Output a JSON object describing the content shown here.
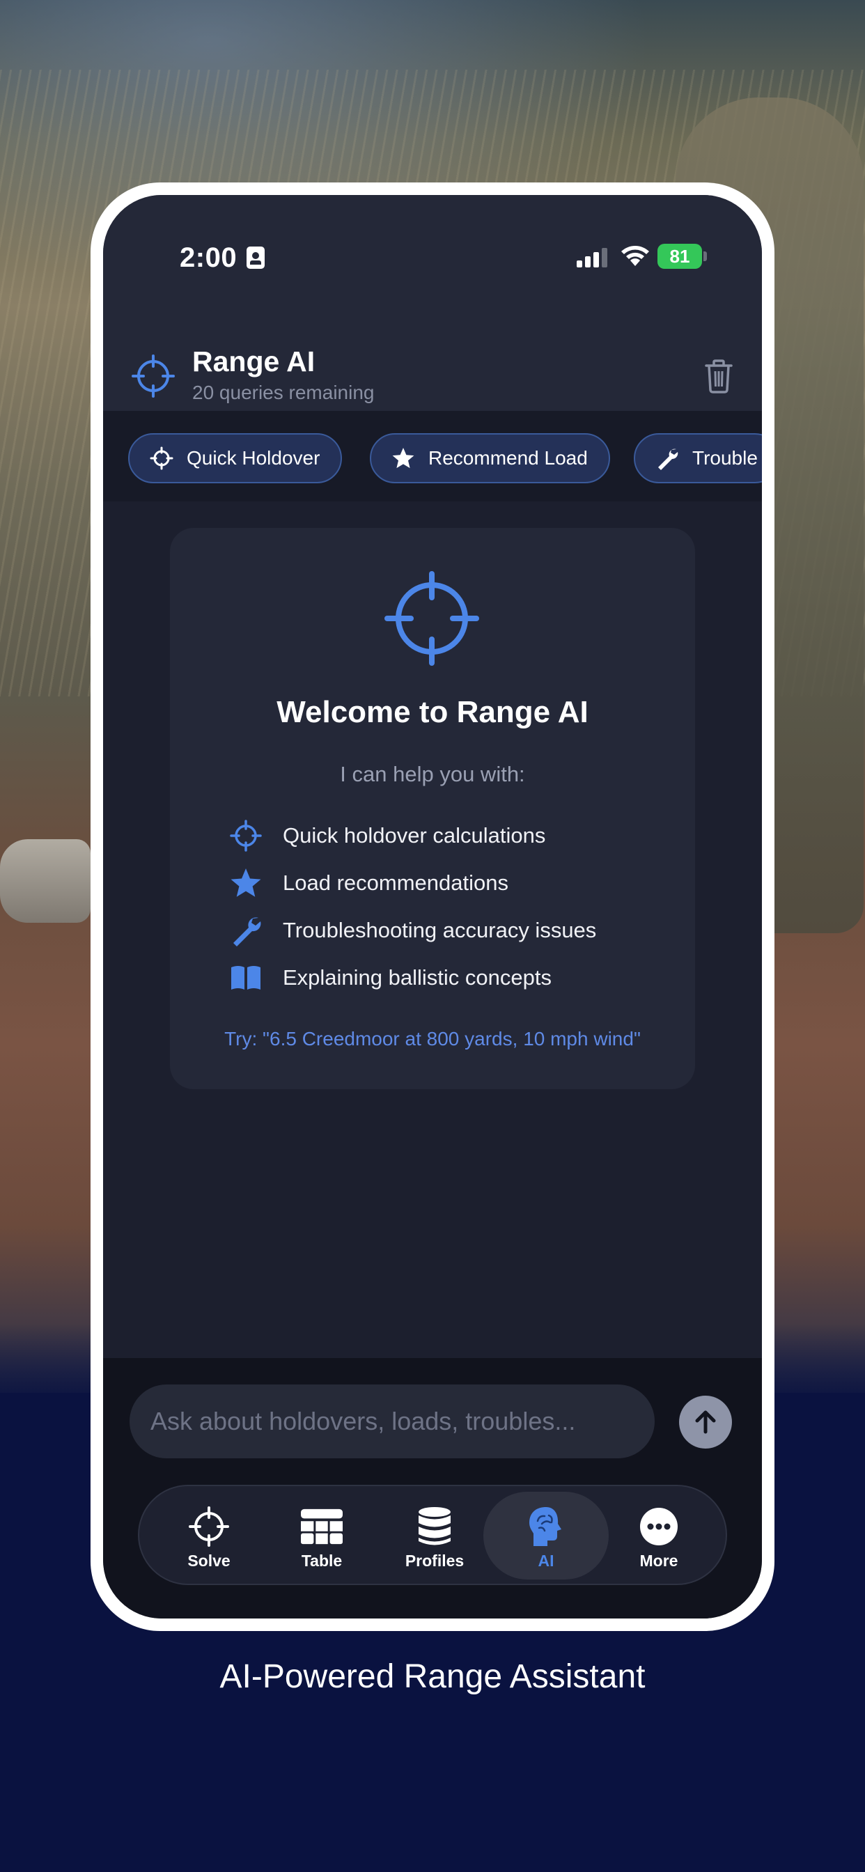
{
  "status_bar": {
    "time": "2:00",
    "battery": "81"
  },
  "header": {
    "title": "Range AI",
    "subtitle": "20 queries remaining"
  },
  "chips": [
    {
      "label": "Quick Holdover",
      "icon": "crosshair-icon"
    },
    {
      "label": "Recommend Load",
      "icon": "star-icon"
    },
    {
      "label": "Trouble",
      "icon": "wrench-icon"
    }
  ],
  "welcome": {
    "title": "Welcome to Range AI",
    "intro": "I can help you with:",
    "features": [
      {
        "label": "Quick holdover calculations",
        "icon": "crosshair-icon"
      },
      {
        "label": "Load recommendations",
        "icon": "star-icon"
      },
      {
        "label": "Troubleshooting accuracy issues",
        "icon": "wrench-icon"
      },
      {
        "label": "Explaining ballistic concepts",
        "icon": "book-icon"
      }
    ],
    "try": "Try: \"6.5 Creedmoor at 800 yards, 10 mph wind\""
  },
  "input": {
    "placeholder": "Ask about holdovers, loads, troubles..."
  },
  "tabs": [
    {
      "label": "Solve",
      "icon": "crosshair-icon",
      "active": false
    },
    {
      "label": "Table",
      "icon": "table-icon",
      "active": false
    },
    {
      "label": "Profiles",
      "icon": "database-icon",
      "active": false
    },
    {
      "label": "AI",
      "icon": "brain-icon",
      "active": true
    },
    {
      "label": "More",
      "icon": "more-icon",
      "active": false
    }
  ],
  "caption": "AI-Powered Range Assistant",
  "colors": {
    "accent": "#4c86e8",
    "chip_bg": "#243158",
    "card_bg": "#242838",
    "screen_bg": "#1c1f2e",
    "page_bg": "#0a1240",
    "battery": "#34c759"
  }
}
